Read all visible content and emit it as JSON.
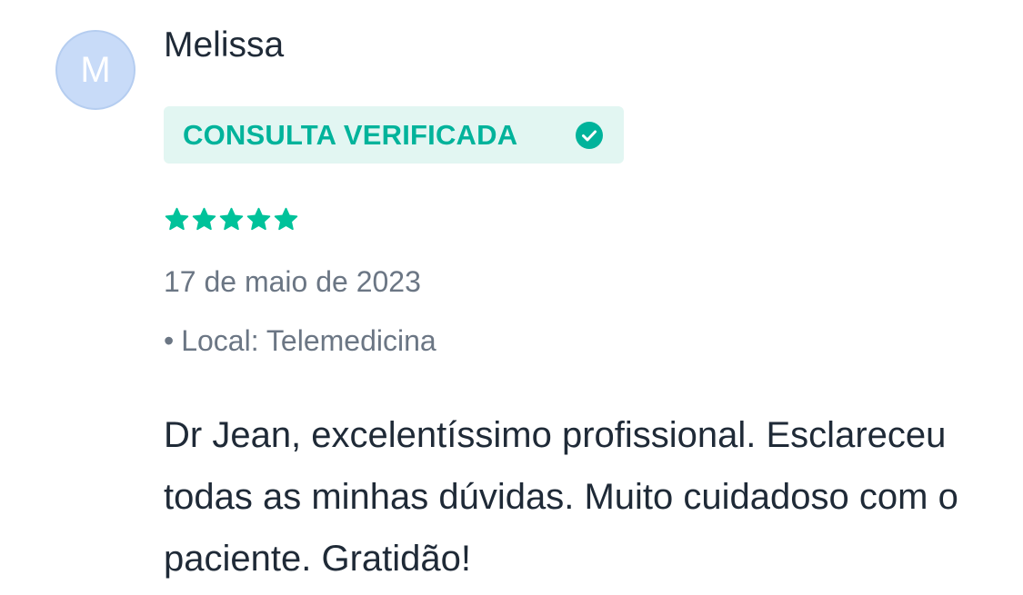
{
  "review": {
    "avatar_initial": "M",
    "author": "Melissa",
    "badge_label": "CONSULTA VERIFICADA",
    "rating": 5,
    "rating_max": 5,
    "date": "17 de maio de 2023",
    "location_bullet": "•",
    "location": "Local: Telemedicina",
    "comment": "Dr Jean, excelentíssimo profissional. Esclareceu todas as minhas dúvidas. Muito cuidadoso com o paciente. Gratidão!"
  },
  "colors": {
    "accent": "#00c29a",
    "badge_bg": "#e2f6f2",
    "avatar_bg": "#c8dbf8",
    "text_primary": "#1f2a37",
    "text_secondary": "#6b7684"
  },
  "icons": {
    "verified": "check-circle-icon",
    "star": "star-icon"
  }
}
